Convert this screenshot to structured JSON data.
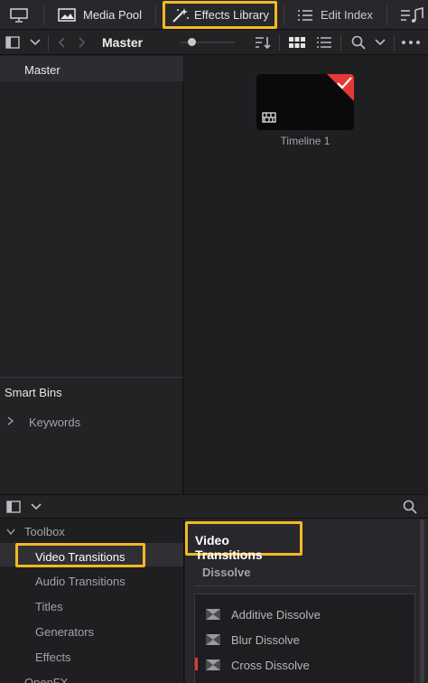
{
  "toolbar": {
    "media_pool": "Media Pool",
    "effects_library": "Effects Library",
    "edit_index": "Edit Index"
  },
  "browser": {
    "breadcrumb": "Master"
  },
  "bins": {
    "master": "Master",
    "smart_bins": "Smart Bins",
    "keywords": "Keywords"
  },
  "media": {
    "clip_name": "Timeline 1"
  },
  "effects": {
    "tree": {
      "toolbox": "Toolbox",
      "video_transitions": "Video Transitions",
      "audio_transitions": "Audio Transitions",
      "titles": "Titles",
      "generators": "Generators",
      "effects": "Effects",
      "openfx": "OpenFX"
    },
    "section_title": "Video Transitions",
    "group": "Dissolve",
    "items": [
      "Additive Dissolve",
      "Blur Dissolve",
      "Cross Dissolve"
    ]
  },
  "colors": {
    "highlight": "#f2b824",
    "accent_red": "#e53935"
  }
}
